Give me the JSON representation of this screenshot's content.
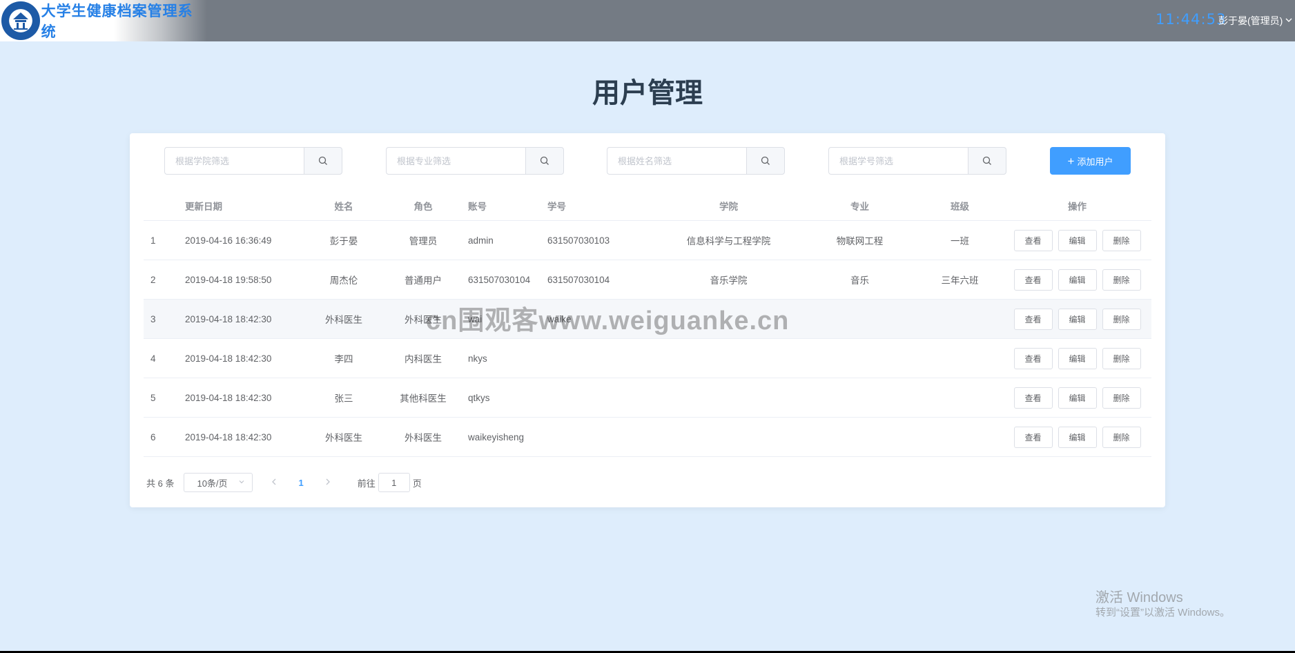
{
  "header": {
    "app_title": "大学生健康档案管理系统",
    "clock": "11:44:53",
    "user": "彭于晏(管理员)"
  },
  "page": {
    "title": "用户管理"
  },
  "filters": {
    "college_placeholder": "根据学院筛选",
    "major_placeholder": "根据专业筛选",
    "name_placeholder": "根据姓名筛选",
    "student_no_placeholder": "根据学号筛选",
    "add_user_label": "添加用户"
  },
  "table": {
    "headers": {
      "date": "更新日期",
      "name": "姓名",
      "role": "角色",
      "account": "账号",
      "student_no": "学号",
      "college": "学院",
      "major": "专业",
      "class": "班级",
      "ops": "操作"
    },
    "actions": {
      "view": "查看",
      "edit": "编辑",
      "delete": "删除"
    },
    "rows": [
      {
        "idx": "1",
        "date": "2019-04-16 16:36:49",
        "name": "彭于晏",
        "role": "管理员",
        "account": "admin",
        "student_no": "631507030103",
        "college": "信息科学与工程学院",
        "major": "物联网工程",
        "class": "一班"
      },
      {
        "idx": "2",
        "date": "2019-04-18 19:58:50",
        "name": "周杰伦",
        "role": "普通用户",
        "account": "631507030104",
        "student_no": "631507030104",
        "college": "音乐学院",
        "major": "音乐",
        "class": "三年六班"
      },
      {
        "idx": "3",
        "date": "2019-04-18 18:42:30",
        "name": "外科医生",
        "role": "外科医生",
        "account": "wai",
        "student_no": "waike",
        "college": "",
        "major": "",
        "class": ""
      },
      {
        "idx": "4",
        "date": "2019-04-18 18:42:30",
        "name": "李四",
        "role": "内科医生",
        "account": "nkys",
        "student_no": "",
        "college": "",
        "major": "",
        "class": ""
      },
      {
        "idx": "5",
        "date": "2019-04-18 18:42:30",
        "name": "张三",
        "role": "其他科医生",
        "account": "qtkys",
        "student_no": "",
        "college": "",
        "major": "",
        "class": ""
      },
      {
        "idx": "6",
        "date": "2019-04-18 18:42:30",
        "name": "外科医生",
        "role": "外科医生",
        "account": "waikeyisheng",
        "student_no": "",
        "college": "",
        "major": "",
        "class": ""
      }
    ]
  },
  "pagination": {
    "total": "共 6 条",
    "page_size": "10条/页",
    "current_page": "1",
    "goto_prefix": "前往",
    "goto_value": "1",
    "goto_suffix": "页"
  },
  "overlay": {
    "watermark": "cn围观客www.weiguanke.cn",
    "activate_title": "激活 Windows",
    "activate_hint": "转到“设置”以激活 Windows。"
  },
  "colors": {
    "primary": "#409eff",
    "header_bg": "#747b84",
    "page_bg": "#deedfc"
  },
  "icons": {
    "search": "search-icon",
    "plus": "plus-icon",
    "chevron": "chevron-down-icon",
    "logo": "university-emblem"
  }
}
